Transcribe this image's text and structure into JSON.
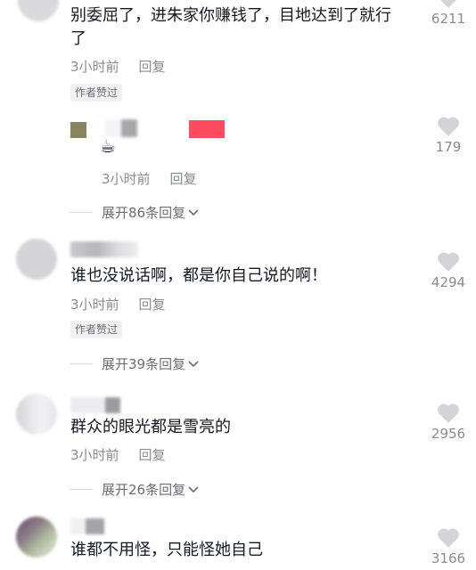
{
  "comments": [
    {
      "text_line1": "别委屈了，进朱家你赚钱了，目地达到了就行",
      "text_line2": "了",
      "time": "3小时前",
      "reply": "回复",
      "badge": "作者赞过",
      "likes": "6211"
    },
    {
      "sub_reply": true,
      "emoji": "☕",
      "time": "3小时前",
      "reply": "回复",
      "likes": "179",
      "expand": "展开86条回复"
    },
    {
      "text": "谁也没说话啊，都是你自己说的啊！",
      "time": "3小时前",
      "reply": "回复",
      "badge": "作者赞过",
      "likes": "4294",
      "expand": "展开39条回复"
    },
    {
      "text": "群众的眼光都是雪亮的",
      "time": "3小时前",
      "reply": "回复",
      "likes": "2956",
      "expand": "展开26条回复"
    },
    {
      "text": "谁都不用怪，只能怪她自己",
      "likes": "3166"
    }
  ],
  "colors": {
    "text": "#161823",
    "meta": "#8a8b91",
    "heart": "#d4d4d8",
    "accent_red": "#fe2c55"
  },
  "icons": {
    "like": "heart-icon",
    "expand": "chevron-down-icon"
  }
}
